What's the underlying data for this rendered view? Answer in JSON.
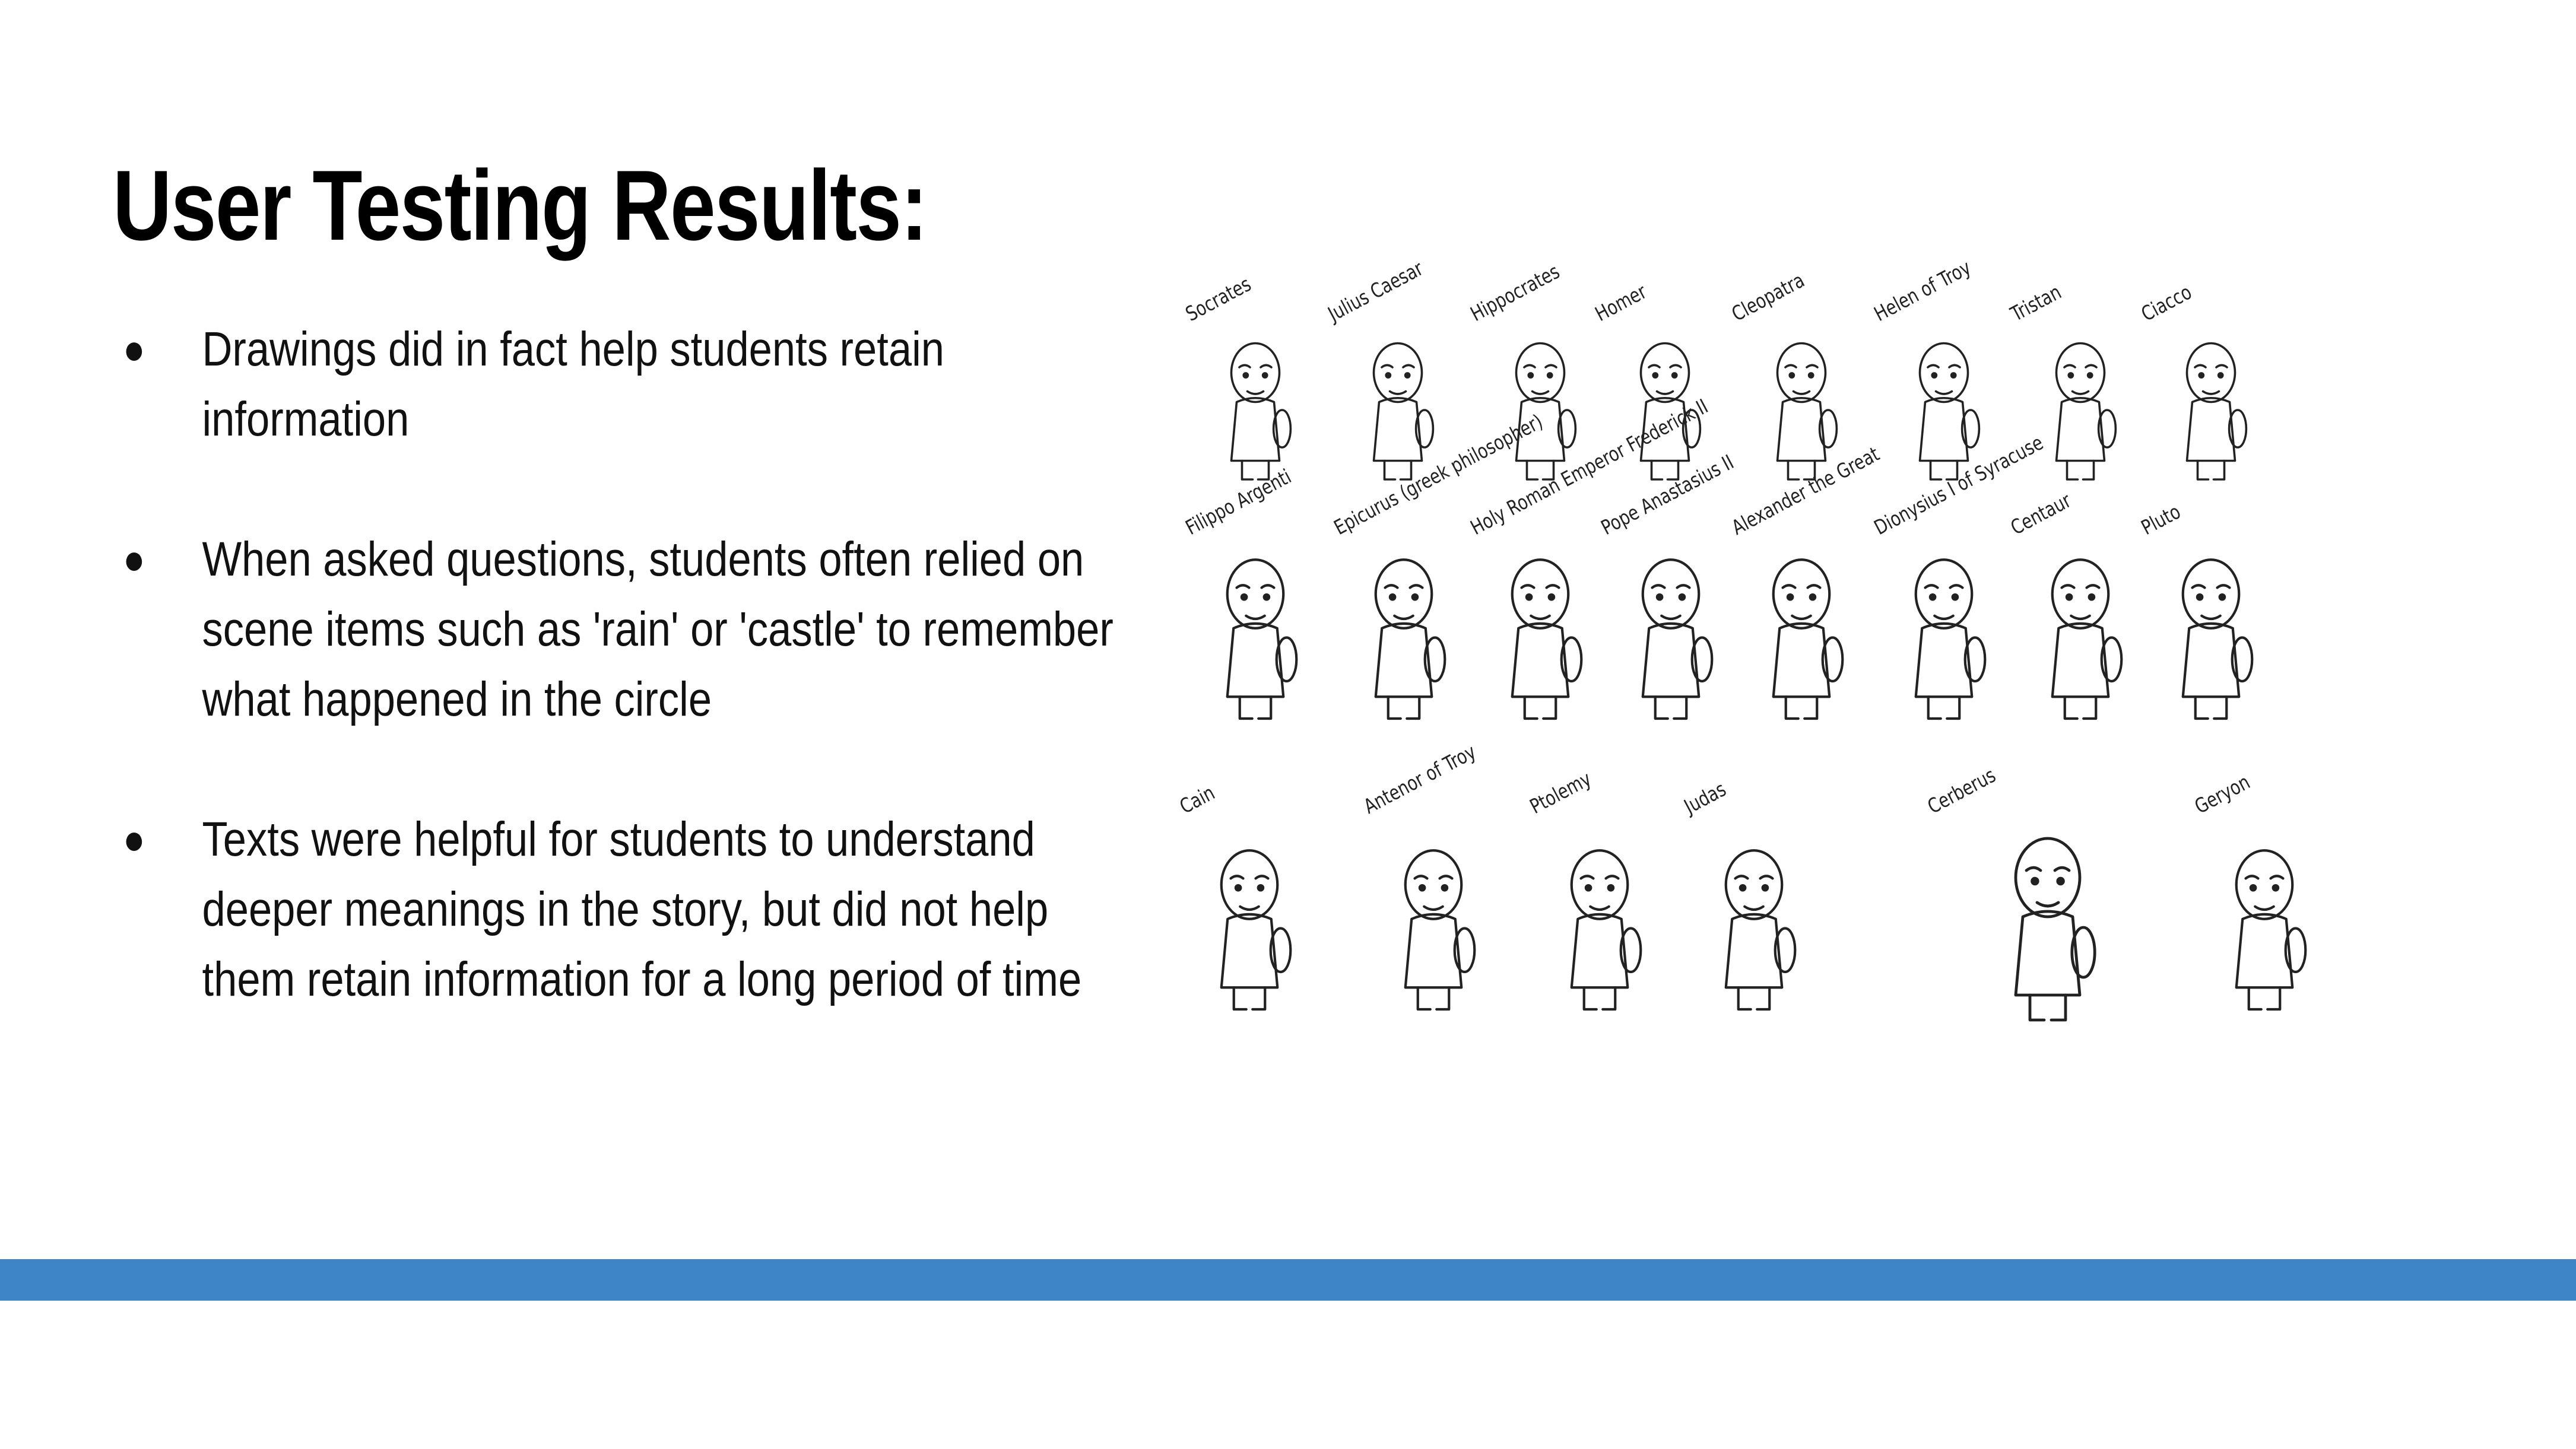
{
  "slide": {
    "title": "User Testing Results:",
    "bullets": [
      {
        "lines": [
          "Drawings did in fact help students retain",
          "information"
        ]
      },
      {
        "lines": [
          "When asked questions, students often relied on",
          "scene items such as 'rain' or 'castle' to remember",
          "what happened in the circle"
        ]
      },
      {
        "lines": [
          "Texts were helpful for students to understand",
          "deeper meanings in the story, but did not help",
          "them retain information for a long period of time"
        ]
      }
    ],
    "bullet_symbol": "●",
    "accent_color": "#3d85c6"
  },
  "gallery": {
    "row1": [
      "Socrates",
      "Julius Caesar",
      "Hippocrates",
      "Homer",
      "Cleopatra",
      "Helen of Troy",
      "Tristan",
      "Ciacco"
    ],
    "row2": [
      "Filippo Argenti",
      "Epicurus (greek philosopher)",
      "Holy Roman Emperor Frederick II",
      "Pope Anastasius II",
      "Alexander the Great",
      "Dionysius I of Syracuse",
      "Centaur",
      "Pluto"
    ],
    "row3": [
      "Cain",
      "Antenor of Troy",
      "Ptolemy",
      "Judas",
      "Cerberus",
      "Geryon"
    ]
  }
}
